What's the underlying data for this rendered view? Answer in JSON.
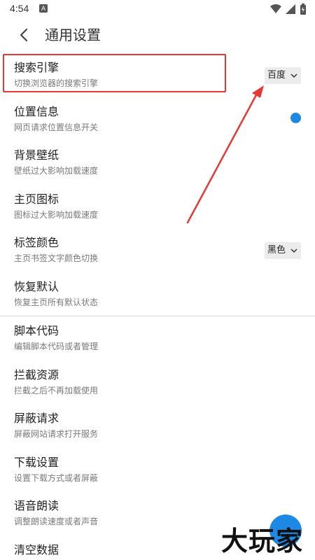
{
  "status_bar": {
    "time": "4:54",
    "notif_letter": "A"
  },
  "header": {
    "title": "通用设置"
  },
  "settings": [
    {
      "title": "搜索引擎",
      "subtitle": "切换浏览器的搜索引擎",
      "control": "select",
      "value": "百度"
    },
    {
      "title": "位置信息",
      "subtitle": "网页请求位置信息开关",
      "control": "toggle",
      "value": "on"
    },
    {
      "title": "背景壁纸",
      "subtitle": "壁纸过大影响加载速度"
    },
    {
      "title": "主页图标",
      "subtitle": "图标过大影响加载速度"
    },
    {
      "title": "标签颜色",
      "subtitle": "主页书签文字颜色切换",
      "control": "select",
      "value": "黑色"
    },
    {
      "title": "恢复默认",
      "subtitle": "恢复主页所有默认状态"
    },
    {
      "title": "脚本代码",
      "subtitle": "编辑脚本代码或者管理"
    },
    {
      "title": "拦截资源",
      "subtitle": "拦截之后不再加载使用"
    },
    {
      "title": "屏蔽请求",
      "subtitle": "屏蔽网站请求打开服务"
    },
    {
      "title": "下载设置",
      "subtitle": "设置下载方式或者屏蔽"
    },
    {
      "title": "语音朗读",
      "subtitle": "调整朗读速度或者声音"
    },
    {
      "title": "清空数据",
      "subtitle": ""
    }
  ],
  "watermark": {
    "text": "大玩家"
  },
  "colors": {
    "accent": "#1e88e5",
    "highlight": "#e53935"
  }
}
